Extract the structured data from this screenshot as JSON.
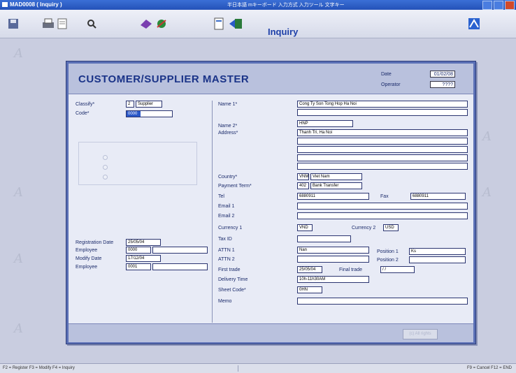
{
  "window": {
    "title": "MAD0008 ( Inquiry )",
    "ime": "半日本語 mキーボード 入力方式 入力ツール 文字キー"
  },
  "toolbar": {
    "mode_label": "Inquiry"
  },
  "form": {
    "title": "CUSTOMER/SUPPLIER MASTER",
    "date_label": "Date",
    "date_value": "01/02/08",
    "operator_label": "Operator",
    "operator_value": "????",
    "left": {
      "classify_label": "Classify*",
      "classify_code": "2",
      "classify_value": "Supplier",
      "code_label": "Code*",
      "code_value": "0000",
      "registration_date_label": "Registration Date",
      "registration_date_value": "25/05/04",
      "employee1_label": "Employee",
      "employee1_value": "0000",
      "modify_date_label": "Modify Date",
      "modify_date_value": "17/12/04",
      "employee2_label": "Employee",
      "employee2_value": "0001"
    },
    "right": {
      "name1_label": "Name 1*",
      "name1_value": "Cong Ty Son Tong Hop Ha Noi",
      "name2_label": "Name 2*",
      "name2_value": "HNP",
      "address_label": "Address*",
      "address_value": "Thanh Tri, Ha Noi",
      "country_label": "Country*",
      "country_code": "VNM",
      "country_name": "Viet Nam",
      "payment_label": "Payment Term*",
      "payment_code": "402",
      "payment_name": "Bank Transfer",
      "tel_label": "Tel",
      "tel_value": "6880911",
      "fax_label": "Fax",
      "fax_value": "6880911",
      "email1_label": "Email 1",
      "email2_label": "Email 2",
      "currency1_label": "Currency 1",
      "currency1_value": "VND",
      "currency2_label": "Currency 2",
      "currency2_value": "USD",
      "taxid_label": "Tax ID",
      "attn1_label": "ATTN 1",
      "attn1_value": "Nan",
      "position1_label": "Position 1",
      "position1_value": "Ks",
      "attn2_label": "ATTN 2",
      "position2_label": "Position 2",
      "first_trade_label": "First trade",
      "first_trade_value": "25/05/04",
      "final_trade_label": "Final trade",
      "final_trade_value": "/ /",
      "delivery_time_label": "Delivery Time",
      "delivery_time_value": "10h-11h30AM",
      "sheet_code_label": "Sheet Code*",
      "sheet_code_value": "0HN",
      "memo_label": "Memo"
    },
    "footer_button": "(c) All rights"
  },
  "status": {
    "left": "F2 = Register  F3 = Modify  F4 = Inquiry",
    "right": "F9 = Cancel  F12 = END"
  }
}
